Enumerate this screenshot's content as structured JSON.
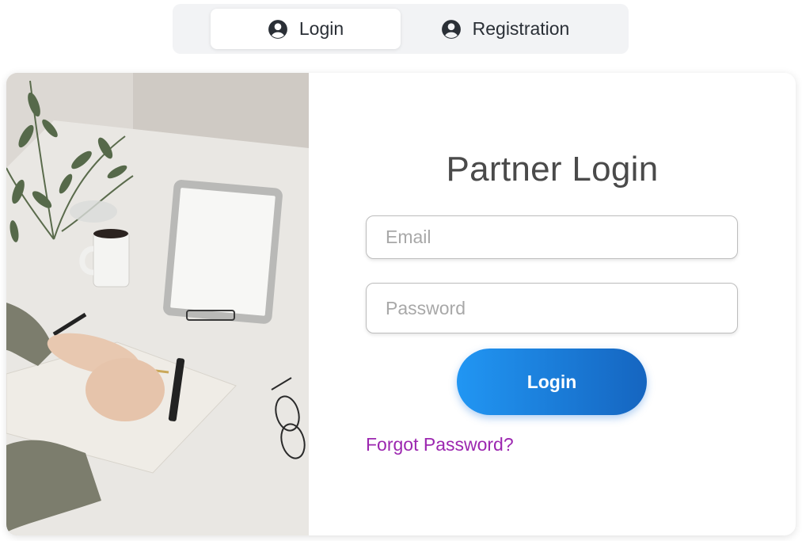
{
  "tabs": {
    "login_label": "Login",
    "registration_label": "Registration",
    "active": "login"
  },
  "form": {
    "title": "Partner Login",
    "email_placeholder": "Email",
    "password_placeholder": "Password",
    "login_button": "Login",
    "forgot_password": "Forgot Password?"
  },
  "icons": {
    "tab_icon": "user-circle-icon"
  },
  "colors": {
    "button_gradient_start": "#2196f3",
    "button_gradient_end": "#1565c0",
    "link": "#9c27b0",
    "title": "#4a4a4a"
  }
}
